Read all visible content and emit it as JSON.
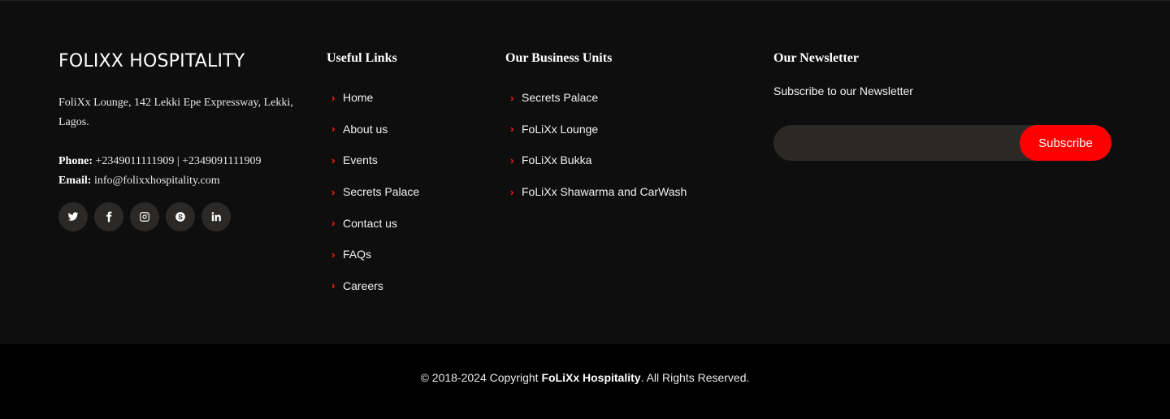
{
  "brand": {
    "name": "FOLIXX HOSPITALITY",
    "address": "FoliXx Lounge, 142 Lekki Epe Expressway, Lekki, Lagos.",
    "phone_label": "Phone:",
    "phone": "+2349011111909 | +2349091111909",
    "email_label": "Email:",
    "email": "info@folixxhospitality.com",
    "socials": [
      {
        "icon": "twitter-icon"
      },
      {
        "icon": "facebook-icon"
      },
      {
        "icon": "instagram-icon"
      },
      {
        "icon": "skype-icon"
      },
      {
        "icon": "linkedin-icon"
      }
    ]
  },
  "useful_links": {
    "title": "Useful Links",
    "items": [
      "Home",
      "About us",
      "Events",
      "Secrets Palace",
      "Contact us",
      "FAQs",
      "Careers"
    ]
  },
  "business_units": {
    "title": "Our Business Units",
    "items": [
      "Secrets Palace",
      "FoLiXx Lounge",
      "FoLiXx Bukka",
      "FoLiXx Shawarma and CarWash"
    ]
  },
  "newsletter": {
    "title": "Our Newsletter",
    "subtitle": "Subscribe to our Newsletter",
    "input_value": "",
    "button_label": "Subscribe"
  },
  "footer": {
    "copyright_prefix": "© 2018-2024 Copyright",
    "company": "FoLiXx Hospitality",
    "suffix": ". All Rights Reserved."
  },
  "colors": {
    "accent": "#ff0000",
    "background_top": "#0f0e0e",
    "background_bottom": "#000000"
  }
}
